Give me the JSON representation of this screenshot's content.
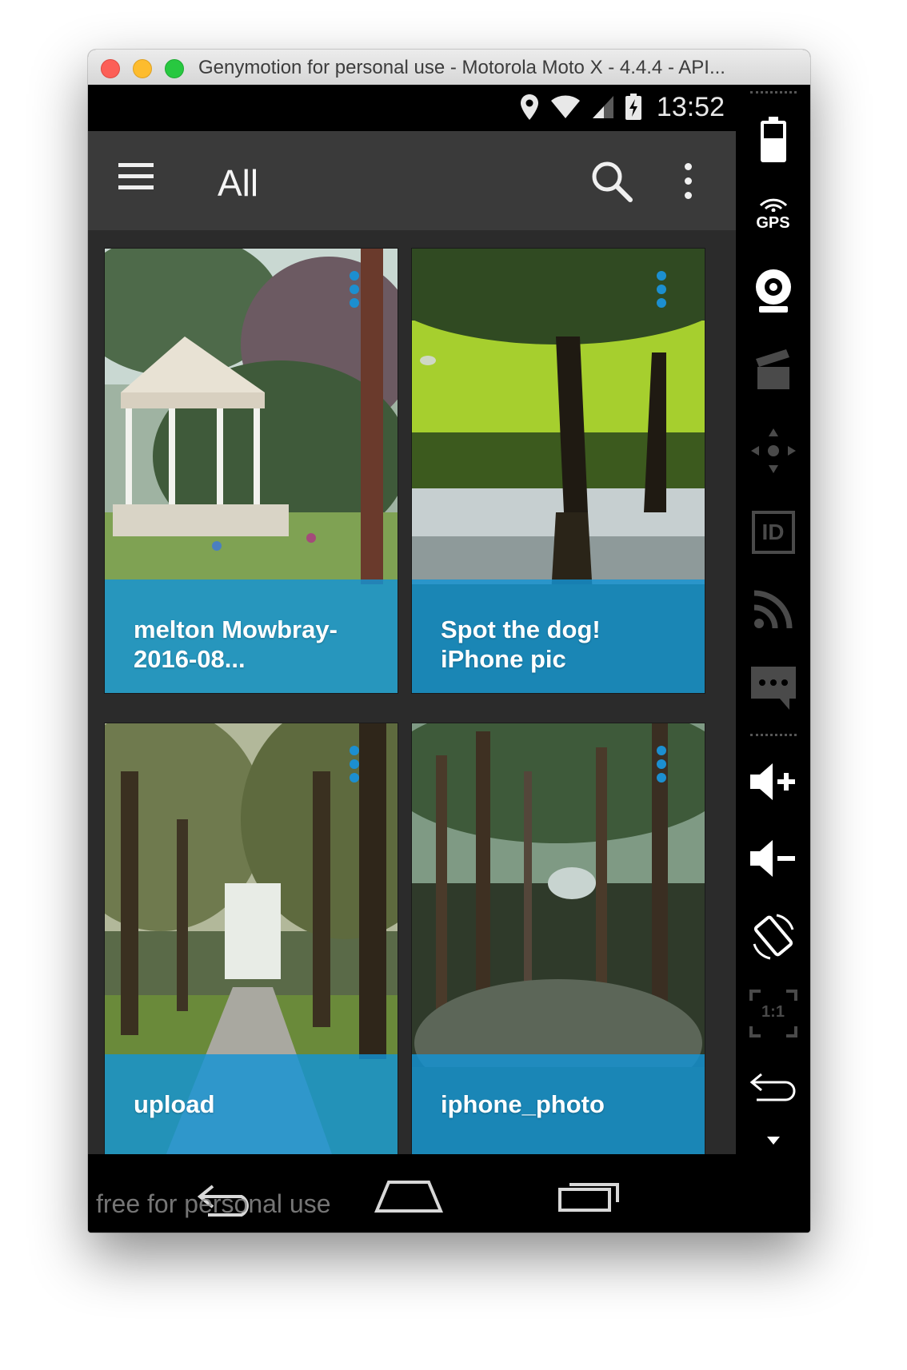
{
  "window": {
    "title": "Genymotion for personal use - Motorola Moto X - 4.4.4 - API..."
  },
  "statusbar": {
    "time": "13:52"
  },
  "appbar": {
    "title": "All"
  },
  "cards": [
    {
      "label": "melton Mowbray-2016-08..."
    },
    {
      "label": "Spot the dog! iPhone pic"
    },
    {
      "label": "upload"
    },
    {
      "label": "iphone_photo"
    }
  ],
  "watermark": "free for personal use",
  "sidepanel": {
    "gps_label": "GPS",
    "id_label": "ID",
    "ratio_label": "1:1"
  },
  "colors": {
    "accent": "#1494d4",
    "appbar": "#3a3a3a",
    "background": "#2b2b2b"
  }
}
